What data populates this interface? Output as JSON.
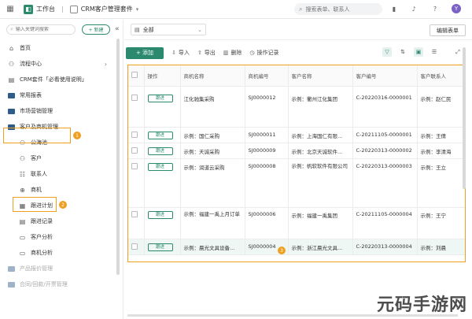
{
  "topbar": {
    "app_name": "工作台",
    "separator": "|",
    "suite_name": "CRM客户管理套件",
    "search_placeholder": "搜索表单、联系人",
    "avatar_letter": "Y"
  },
  "sidebar": {
    "search_placeholder": "输入关键词搜索",
    "new_label": "+ 新建",
    "collapse_label": "«",
    "items": [
      {
        "label": "首页"
      },
      {
        "label": "流程中心",
        "arrow": "›"
      },
      {
        "label": "CRM套件「必看使用说明」"
      },
      {
        "label": "常用报表"
      },
      {
        "label": "市场营销管理"
      },
      {
        "label": "客户及商机管理",
        "badge": "1"
      },
      {
        "label": "公海池"
      },
      {
        "label": "客户"
      },
      {
        "label": "联系人"
      },
      {
        "label": "商机",
        "badge": "2"
      },
      {
        "label": "跟进计划"
      },
      {
        "label": "跟进记录"
      },
      {
        "label": "客户分析"
      },
      {
        "label": "商机分析"
      },
      {
        "label": "产品报价管理"
      },
      {
        "label": "合同/回款/开票管理"
      }
    ]
  },
  "main": {
    "view_label": "全部",
    "edit_form_label": "编辑表单",
    "toolbar": {
      "add": "+ 添加",
      "import": "导入",
      "export": "导出",
      "delete": "删除",
      "log": "操作记录"
    },
    "table": {
      "headers": [
        "操作",
        "商机名称",
        "商机编号",
        "客户名称",
        "客户编号",
        "客户联系人"
      ],
      "follow_label": "跟进",
      "rows": [
        {
          "name": "江化驰集采购",
          "code": "SJ0000012",
          "customer": "示例：衢州江化集团",
          "cust_code": "C-20220316-0000001",
          "contact": "示例：赵仁民"
        },
        {
          "name": "示例：国仁采购",
          "code": "SJ0000011",
          "customer": "示例：上海国仁有限...",
          "cust_code": "C-20211105-0000001",
          "contact": "示例：王倩"
        },
        {
          "name": "示例：天诚采购",
          "code": "SJ0000009",
          "customer": "示例：北京天诚软件...",
          "cust_code": "C-20220313-0000002",
          "contact": "示例：李清海"
        },
        {
          "name": "示例：润道云采购",
          "code": "SJ0000008",
          "customer": "示例：帆软软件有限公司",
          "cust_code": "C-20220313-0000003",
          "contact": "示例：王立"
        },
        {
          "name": "示例：福建一禹上月订单",
          "code": "SJ0000006",
          "customer": "示例：福建一禹集团",
          "cust_code": "C-20211105-0000004",
          "contact": "示例：王宁"
        },
        {
          "name": "示例：晨光文具设备...",
          "code": "SJ0000004",
          "customer": "示例：浙江晨光文具...",
          "cust_code": "C-20220313-0000004",
          "contact": "示例：刘晨"
        }
      ]
    },
    "badge3": "3"
  },
  "watermark": "元码手游网",
  "colors": {
    "brand": "#2b8a6e",
    "highlight": "#f0a020"
  }
}
